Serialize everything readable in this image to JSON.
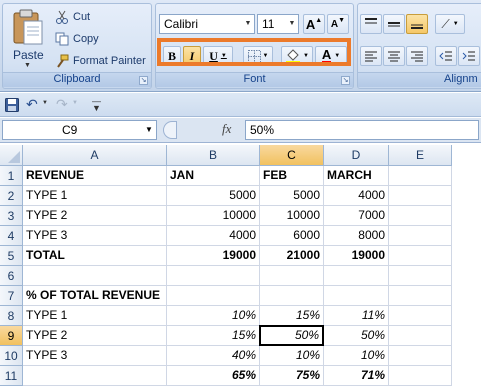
{
  "ribbon": {
    "clipboard": {
      "label": "Clipboard",
      "paste": "Paste",
      "cut": "Cut",
      "copy": "Copy",
      "format_painter": "Format Painter"
    },
    "font": {
      "label": "Font",
      "font_name": "Calibri",
      "font_size": "11",
      "grow": "A",
      "shrink": "A",
      "bold": "B",
      "italic": "I",
      "underline": "U",
      "font_color_letter": "A"
    },
    "alignment": {
      "label": "Alignm"
    },
    "highlight_color": "#ec7a2b"
  },
  "formula_bar": {
    "name_box": "C9",
    "fx": "fx",
    "value": "50%"
  },
  "grid": {
    "columns": [
      "A",
      "B",
      "C",
      "D",
      "E"
    ],
    "rows": [
      "1",
      "2",
      "3",
      "4",
      "5",
      "6",
      "7",
      "8",
      "9",
      "10",
      "11"
    ],
    "selected_col": "C",
    "selected_row": "9",
    "cells": [
      [
        "REVENUE",
        "JAN",
        "FEB",
        "MARCH",
        ""
      ],
      [
        "TYPE 1",
        "5000",
        "5000",
        "4000",
        ""
      ],
      [
        "TYPE 2",
        "10000",
        "10000",
        "7000",
        ""
      ],
      [
        "TYPE 3",
        "4000",
        "6000",
        "8000",
        ""
      ],
      [
        "TOTAL",
        "19000",
        "21000",
        "19000",
        ""
      ],
      [
        "",
        "",
        "",
        "",
        ""
      ],
      [
        "% OF TOTAL REVENUE",
        "",
        "",
        "",
        ""
      ],
      [
        "TYPE 1",
        "10%",
        "15%",
        "11%",
        ""
      ],
      [
        "TYPE 2",
        "15%",
        "50%",
        "50%",
        ""
      ],
      [
        "TYPE 3",
        "40%",
        "10%",
        "10%",
        ""
      ],
      [
        "",
        "65%",
        "75%",
        "71%",
        ""
      ]
    ]
  }
}
